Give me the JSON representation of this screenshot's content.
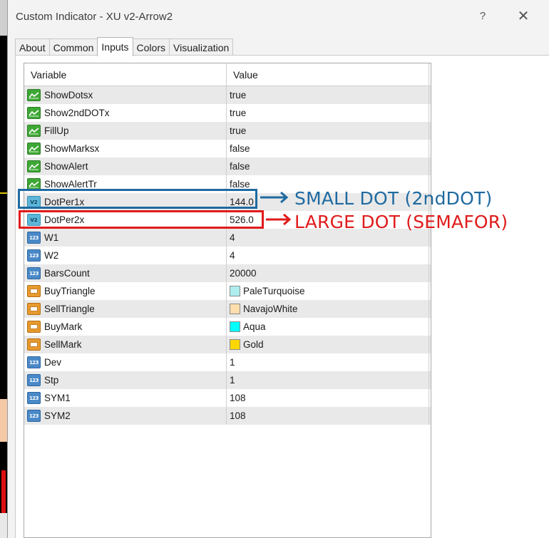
{
  "window": {
    "title": "Custom Indicator - XU v2-Arrow2",
    "help_label": "?",
    "close_label": "✕"
  },
  "tabs": [
    "About",
    "Common",
    "Inputs",
    "Colors",
    "Visualization"
  ],
  "active_tab": "Inputs",
  "grid": {
    "headers": [
      "Variable",
      "Value"
    ],
    "rows": [
      {
        "icon": "bool-icon",
        "name": "ShowDotsx",
        "value": "true"
      },
      {
        "icon": "bool-icon",
        "name": "Show2ndDOTx",
        "value": "true"
      },
      {
        "icon": "bool-icon",
        "name": "FillUp",
        "value": "true"
      },
      {
        "icon": "bool-icon",
        "name": "ShowMarksx",
        "value": "false"
      },
      {
        "icon": "bool-icon",
        "name": "ShowAlert",
        "value": "false"
      },
      {
        "icon": "bool-icon",
        "name": "ShowAlertTr",
        "value": "false"
      },
      {
        "icon": "double-icon",
        "name": "DotPer1x",
        "value": "144.0"
      },
      {
        "icon": "double-icon",
        "name": "DotPer2x",
        "value": "526.0"
      },
      {
        "icon": "int-icon",
        "name": "W1",
        "value": "4"
      },
      {
        "icon": "int-icon",
        "name": "W2",
        "value": "4"
      },
      {
        "icon": "int-icon",
        "name": "BarsCount",
        "value": "20000"
      },
      {
        "icon": "color-icon",
        "name": "BuyTriangle",
        "value": "PaleTurquoise",
        "swatch": "#afeeee"
      },
      {
        "icon": "color-icon",
        "name": "SellTriangle",
        "value": "NavajoWhite",
        "swatch": "#ffdead"
      },
      {
        "icon": "color-icon",
        "name": "BuyMark",
        "value": "Aqua",
        "swatch": "#00ffff"
      },
      {
        "icon": "color-icon",
        "name": "SellMark",
        "value": "Gold",
        "swatch": "#ffd700"
      },
      {
        "icon": "int-icon",
        "name": "Dev",
        "value": "1"
      },
      {
        "icon": "int-icon",
        "name": "Stp",
        "value": "1"
      },
      {
        "icon": "int-icon",
        "name": "SYM1",
        "value": "108"
      },
      {
        "icon": "int-icon",
        "name": "SYM2",
        "value": "108"
      }
    ]
  },
  "icon_glyphs": {
    "double": "V2",
    "int": "123"
  },
  "annotations": {
    "blue_text": "SMALL DOT (2ndDOT)",
    "red_text": "LARGE DOT (SEMAFOR)",
    "blue_color": "#1f6aa0",
    "red_color": "#e01b1b"
  }
}
